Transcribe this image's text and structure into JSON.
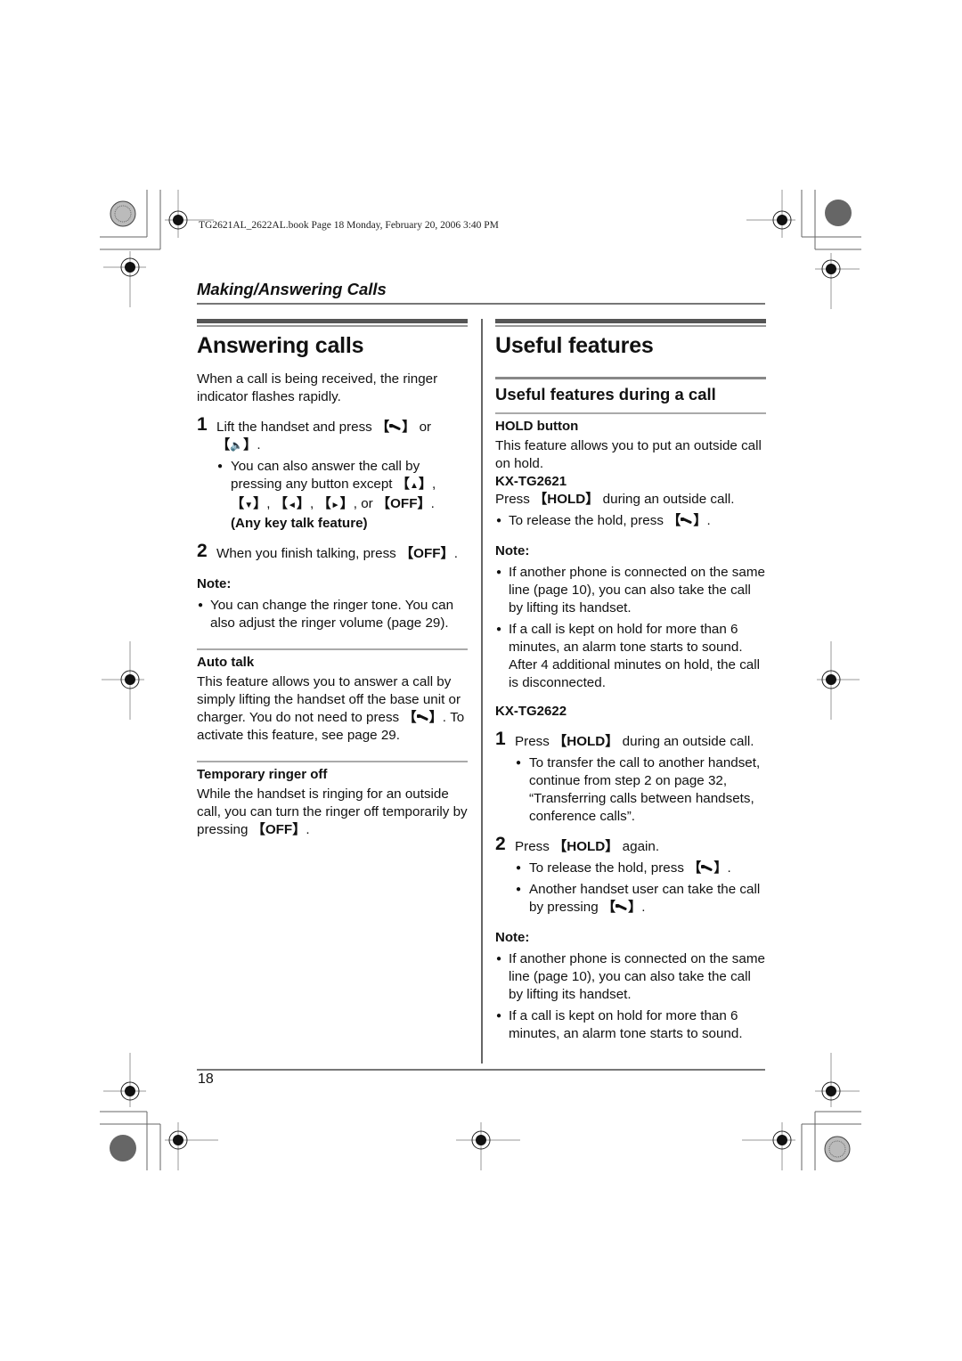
{
  "file_header": "TG2621AL_2622AL.book  Page 18  Monday, February 20, 2006  3:40 PM",
  "section_title": "Making/Answering Calls",
  "page_number": "18",
  "left": {
    "title": "Answering calls",
    "intro": "When a call is being received, the ringer indicator flashes rapidly.",
    "step1": {
      "num": "1",
      "pre": "Lift the handset and press ",
      "mid": " or ",
      "post": ".",
      "bullet_pre": "You can also answer the call by pressing any button except ",
      "keys": [
        "▲",
        "▼",
        "◄",
        "►"
      ],
      "or": ", or ",
      "off": "OFF",
      "bold_tail": "(Any key talk feature)"
    },
    "step2": {
      "num": "2",
      "pre": "When you finish talking, press ",
      "key": "OFF",
      "post": "."
    },
    "note_label": "Note:",
    "note_bullet": "You can change the ringer tone. You can also adjust the ringer volume (page 29).",
    "auto_talk": {
      "heading": "Auto talk",
      "text_pre": "This feature allows you to answer a call by simply lifting the handset off the base unit or charger. You do not need to press ",
      "text_post": ". To activate this feature, see page 29."
    },
    "ringer_off": {
      "heading": "Temporary ringer off",
      "text_pre": "While the handset is ringing for an outside call, you can turn the ringer off temporarily by pressing ",
      "key": "OFF",
      "text_post": "."
    }
  },
  "right": {
    "title": "Useful features",
    "subtitle": "Useful features during a call",
    "hold_heading": "HOLD button",
    "hold_intro": "This feature allows you to put an outside call on hold.",
    "model1": "KX-TG2621",
    "model1_press": "Press ",
    "hold_key": "HOLD",
    "model1_press_post": " during an outside call.",
    "model1_bullet_pre": "To release the hold, press ",
    "model1_bullet_post": ".",
    "note_label": "Note:",
    "note1_bullets": [
      "If another phone is connected on the same line (page 10), you can also take the call by lifting its handset.",
      "If a call is kept on hold for more than 6 minutes, an alarm tone starts to sound. After 4 additional minutes on hold, the call is disconnected."
    ],
    "model2": "KX-TG2622",
    "step1": {
      "num": "1",
      "pre": "Press ",
      "post": " during an outside call.",
      "bullet": "To transfer the call to another handset, continue from step 2 on page 32, “Transferring calls between handsets, conference calls”."
    },
    "step2": {
      "num": "2",
      "pre": "Press ",
      "post": " again.",
      "bullet1_pre": "To release the hold, press ",
      "bullet1_post": ".",
      "bullet2_pre": "Another handset user can take the call by pressing ",
      "bullet2_post": "."
    },
    "note2_bullets": [
      "If another phone is connected on the same line (page 10), you can also take the call by lifting its handset.",
      "If a call is kept on hold for more than 6 minutes, an alarm tone starts to sound."
    ]
  },
  "icons": {
    "talk": "phone-talk-icon",
    "speaker": "speaker-icon"
  }
}
